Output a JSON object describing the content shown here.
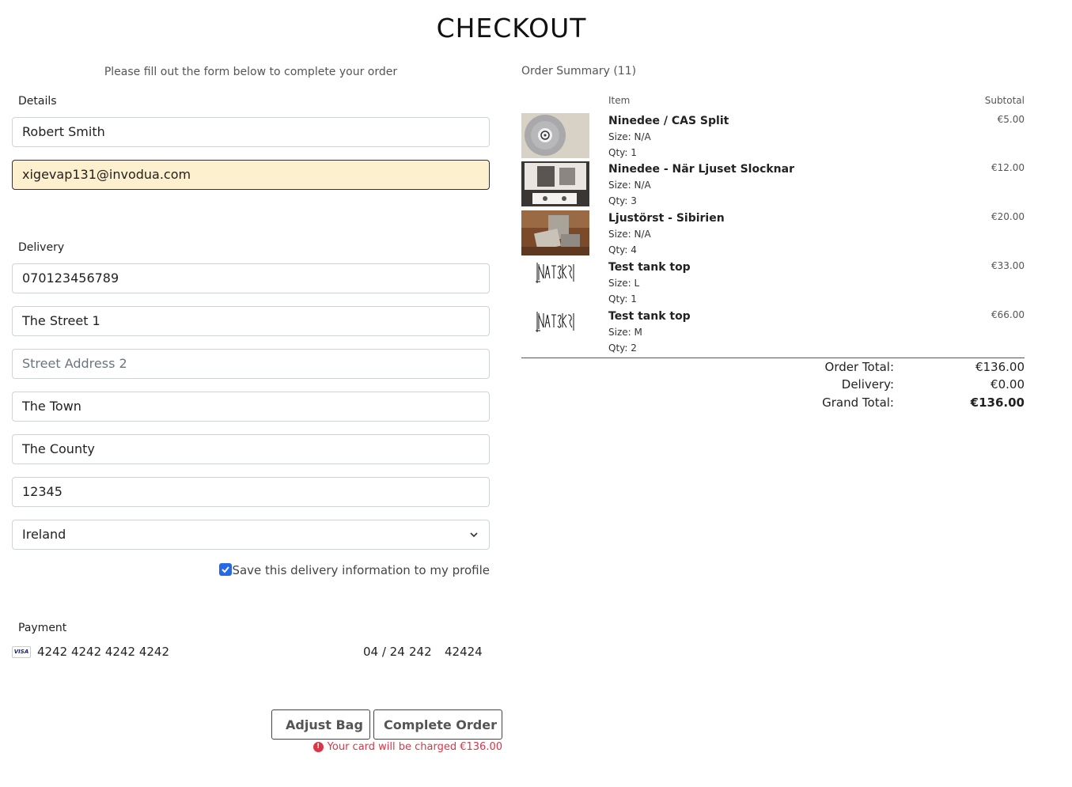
{
  "page": {
    "title": "CHECKOUT",
    "instructions": "Please fill out the form below to complete your order"
  },
  "details": {
    "legend": "Details",
    "full_name": "Robert Smith",
    "email": "xigevap131@invodua.com"
  },
  "delivery": {
    "legend": "Delivery",
    "phone": "070123456789",
    "street1": "The Street 1",
    "street2_placeholder": "Street Address 2",
    "town": "The Town",
    "county": "The County",
    "postcode": "12345",
    "country": "Ireland",
    "save_label": "Save this delivery information to my profile",
    "save_checked": true
  },
  "payment": {
    "legend": "Payment",
    "card_brand": "VISA",
    "card_number": "4242 4242 4242 4242",
    "expiry": "04 / 24",
    "cvc": "242",
    "zip": "42424"
  },
  "actions": {
    "adjust_bag": "Adjust Bag",
    "complete_order": "Complete Order",
    "charge_message": "Your card will be charged €136.00"
  },
  "summary": {
    "title": "Order Summary (11)",
    "col_item": "Item",
    "col_subtotal": "Subtotal",
    "items": [
      {
        "name": "Ninedee / CAS Split",
        "size": "Size: N/A",
        "qty": "Qty: 1",
        "subtotal": "€5.00",
        "thumb": "vinyl-record"
      },
      {
        "name": "Ninedee - När Ljuset Slocknar",
        "size": "Size: N/A",
        "qty": "Qty: 3",
        "subtotal": "€12.00",
        "thumb": "cassette-photo"
      },
      {
        "name": "Ljustörst - Sibirien",
        "size": "Size: N/A",
        "qty": "Qty: 4",
        "subtotal": "€20.00",
        "thumb": "tape-box-photo"
      },
      {
        "name": "Test tank top",
        "size": "Size: L",
        "qty": "Qty: 1",
        "subtotal": "€33.00",
        "thumb": "band-logo"
      },
      {
        "name": "Test tank top",
        "size": "Size: M",
        "qty": "Qty: 2",
        "subtotal": "€66.00",
        "thumb": "band-logo"
      }
    ],
    "order_total_label": "Order Total:",
    "order_total": "€136.00",
    "delivery_label": "Delivery:",
    "delivery_value": "€0.00",
    "grand_total_label": "Grand Total:",
    "grand_total": "€136.00"
  },
  "colors": {
    "checkbox": "#2568e8",
    "autofill": "#fdf0cf",
    "error": "#dc3545"
  }
}
